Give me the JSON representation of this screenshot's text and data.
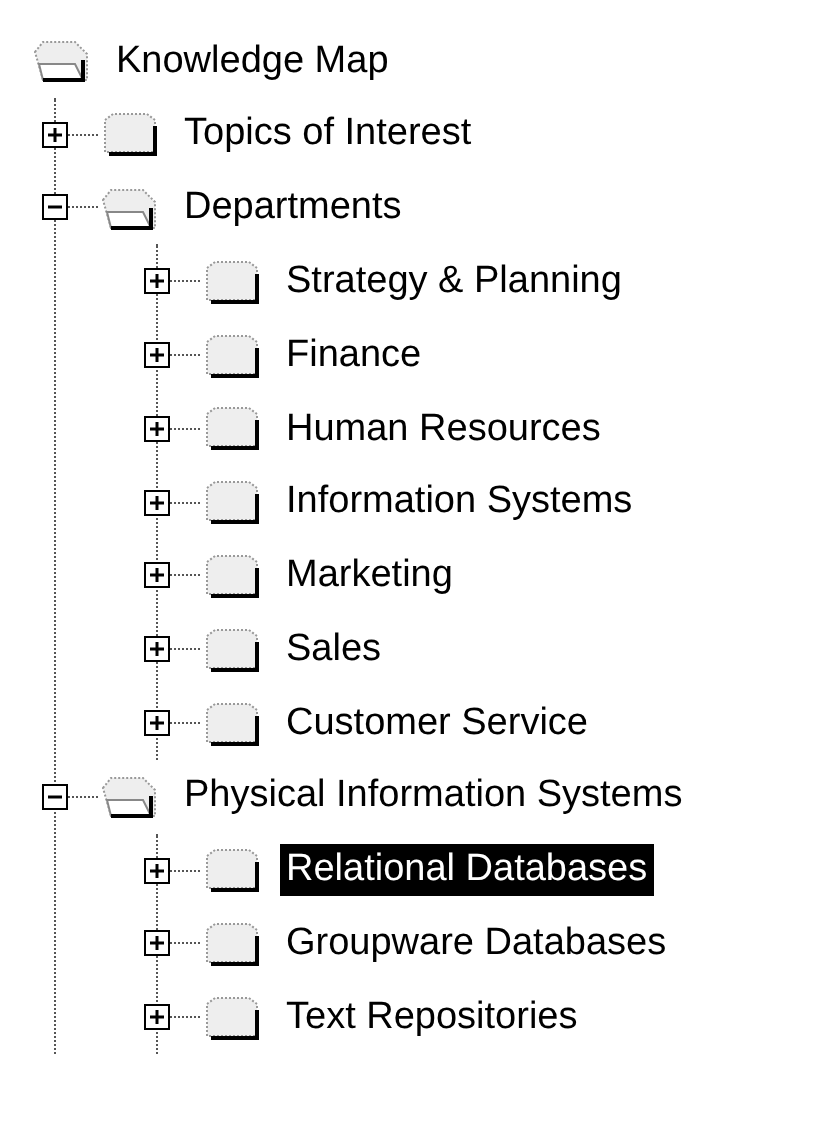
{
  "tree": {
    "label": "Knowledge Map",
    "expanded": true,
    "selected": false,
    "children": [
      {
        "label": "Topics of Interest",
        "expanded": false,
        "selected": false
      },
      {
        "label": "Departments",
        "expanded": true,
        "selected": false,
        "children": [
          {
            "label": "Strategy & Planning",
            "expanded": false,
            "selected": false
          },
          {
            "label": "Finance",
            "expanded": false,
            "selected": false
          },
          {
            "label": "Human Resources",
            "expanded": false,
            "selected": false
          },
          {
            "label": "Information Systems",
            "expanded": false,
            "selected": false
          },
          {
            "label": "Marketing",
            "expanded": false,
            "selected": false
          },
          {
            "label": "Sales",
            "expanded": false,
            "selected": false
          },
          {
            "label": "Customer Service",
            "expanded": false,
            "selected": false
          }
        ]
      },
      {
        "label": "Physical Information Systems",
        "expanded": true,
        "selected": false,
        "children": [
          {
            "label": "Relational Databases",
            "expanded": false,
            "selected": true
          },
          {
            "label": "Groupware Databases",
            "expanded": false,
            "selected": false
          },
          {
            "label": "Text Repositories",
            "expanded": false,
            "selected": false
          }
        ]
      }
    ]
  }
}
